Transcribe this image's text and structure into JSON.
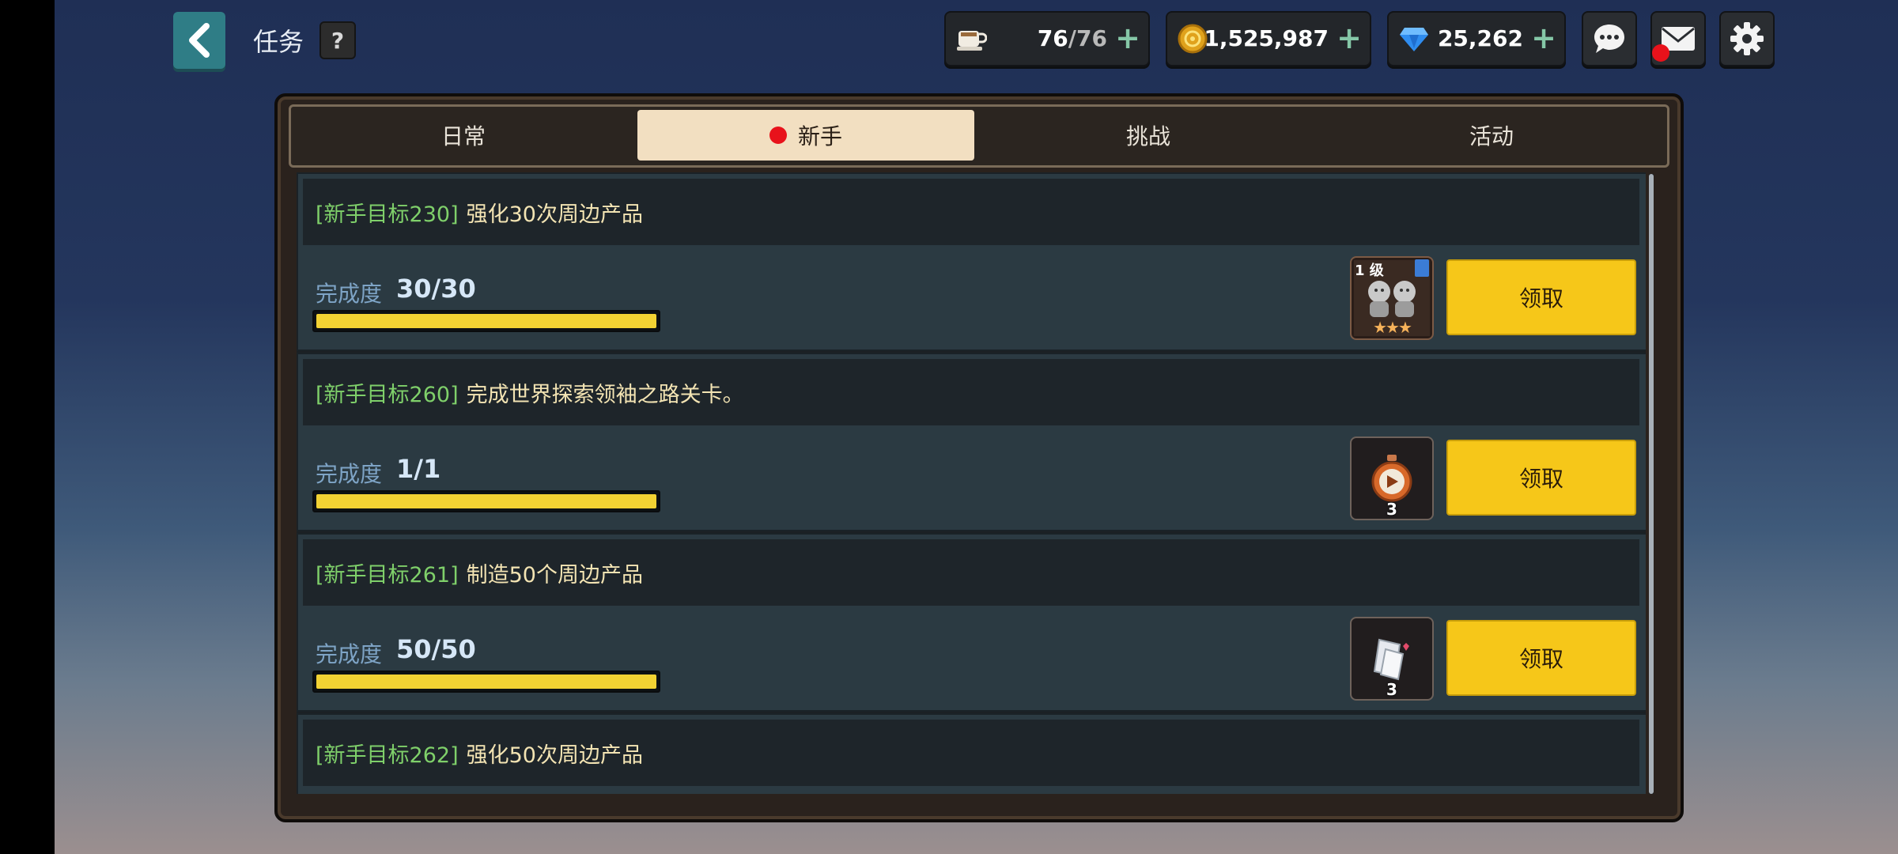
{
  "header": {
    "title": "任务",
    "help_label": "?"
  },
  "currencies": [
    {
      "name": "stamina",
      "icon": "coffee-cup-icon",
      "value": "76",
      "max": "/76"
    },
    {
      "name": "gold",
      "icon": "gold-coin-icon",
      "value": "1,525,987"
    },
    {
      "name": "diamond",
      "icon": "diamond-icon",
      "value": "25,262"
    }
  ],
  "tabs": [
    {
      "label": "日常",
      "active": false
    },
    {
      "label": "新手",
      "active": true,
      "has_alert": true
    },
    {
      "label": "挑战",
      "active": false
    },
    {
      "label": "活动",
      "active": false
    }
  ],
  "quests": [
    {
      "tag": "[新手目标230]",
      "desc": "强化30次周边产品",
      "progress_label": "完成度",
      "progress": "30/30",
      "progress_fraction": 1.0,
      "reward": {
        "icon": "character-card-icon",
        "level": "1 级",
        "stars": "★★★"
      },
      "claim_label": "领取"
    },
    {
      "tag": "[新手目标260]",
      "desc": "完成世界探索领袖之路关卡。",
      "progress_label": "完成度",
      "progress": "1/1",
      "progress_fraction": 1.0,
      "reward": {
        "icon": "stopwatch-icon",
        "count": "3"
      },
      "claim_label": "领取"
    },
    {
      "tag": "[新手目标261]",
      "desc": "制造50个周边产品",
      "progress_label": "完成度",
      "progress": "50/50",
      "progress_fraction": 1.0,
      "reward": {
        "icon": "material-ticket-icon",
        "count": "3"
      },
      "claim_label": "领取"
    },
    {
      "tag": "[新手目标262]",
      "desc": "强化50次周边产品"
    }
  ],
  "colors": {
    "accent_yellow": "#f6c719",
    "tag_green": "#7fd06a",
    "alert_red": "#e8121b"
  }
}
